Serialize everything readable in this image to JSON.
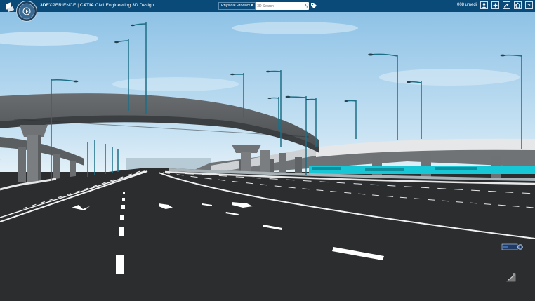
{
  "header": {
    "brand_3d": "3D",
    "brand_experience": "EXPERIENCE | ",
    "brand_catia": "CATIA",
    "brand_app": " Civil Engineering 3D Design",
    "user_name": "008 umedi"
  },
  "search": {
    "scope_label": "Physical Product",
    "placeholder": "3D Search"
  },
  "icons": {
    "compass": "compass-icon",
    "tag": "tag-icon",
    "user": "user-icon",
    "add": "add-icon",
    "share": "share-icon",
    "home": "home-icon",
    "help": "help-icon",
    "camera": "camera-icon",
    "robot": "robot-icon"
  },
  "colors": {
    "topbar": "#0a4a78",
    "sky_top": "#8ec2e6",
    "sky_bottom": "#e3f0f8",
    "road": "#2b2d2f",
    "pole": "#1c6f86",
    "accent_cyan": "#17c7d6"
  }
}
